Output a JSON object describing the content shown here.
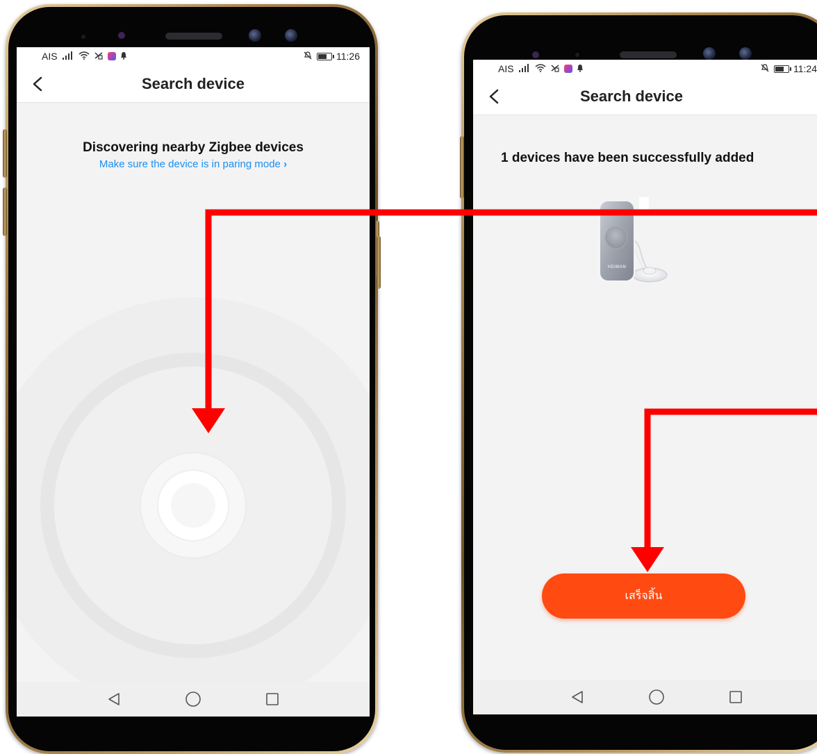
{
  "left_screen": {
    "status": {
      "carrier": "AIS",
      "time": "11:26"
    },
    "header": {
      "title": "Search device"
    },
    "heading": "Discovering nearby Zigbee devices",
    "hint_link": "Make sure the device is in paring mode",
    "hint_chevron": "›"
  },
  "right_screen": {
    "status": {
      "carrier": "AIS",
      "time": "11:24"
    },
    "header": {
      "title": "Search device"
    },
    "success_message": "1 devices have been successfully added",
    "device": {
      "brand_label": "HEIMAN"
    },
    "done_button": {
      "label": "เสร็จสิ้น"
    }
  },
  "annotations": {
    "arrow_color": "#ff0000"
  },
  "icons": {
    "back": "chevron-left-icon",
    "signal": "signal-icon",
    "wifi": "wifi-icon",
    "no_sim": "no-sim-icon",
    "app_notification": "app-notification-icon",
    "notification": "bell-icon",
    "mute": "mute-icon",
    "battery": "battery-icon",
    "nav_back": "triangle-back-icon",
    "nav_home": "circle-home-icon",
    "nav_recents": "square-recents-icon"
  },
  "colors": {
    "accent_orange": "#ff4a12",
    "link_blue": "#1a8ff0",
    "screen_bg": "#f3f3f3"
  }
}
